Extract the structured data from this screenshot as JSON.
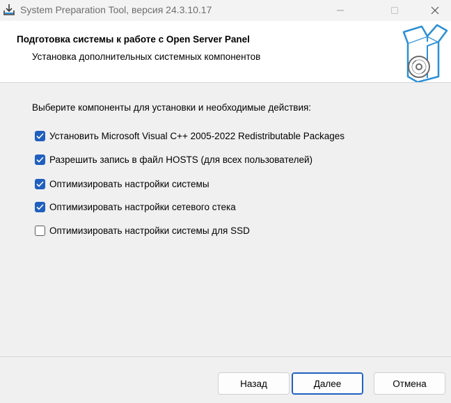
{
  "window": {
    "title": "System Preparation Tool, версия 24.3.10.17"
  },
  "header": {
    "title": "Подготовка системы к работе с Open Server Panel",
    "subtitle": "Установка дополнительных системных компонентов"
  },
  "body": {
    "prompt": "Выберите компоненты для установки и необходимые действия:",
    "options": [
      {
        "label": "Установить Microsoft Visual C++ 2005-2022 Redistributable Packages",
        "checked": true
      },
      {
        "label": "Разрешить запись в файл HOSTS (для всех пользователей)",
        "checked": true
      },
      {
        "label": "Оптимизировать настройки системы",
        "checked": true
      },
      {
        "label": "Оптимизировать настройки сетевого стека",
        "checked": true
      },
      {
        "label": "Оптимизировать настройки системы для SSD",
        "checked": false
      }
    ]
  },
  "buttons": {
    "back": "Назад",
    "next": "Далее",
    "cancel": "Отмена"
  },
  "colors": {
    "accent": "#1f5fbf",
    "header_bg": "#ffffff",
    "body_bg": "#f0f0f0",
    "box_icon": "#2b8fd6"
  },
  "icons": {
    "app": "download-installer-icon",
    "header": "open-box-disc-icon"
  }
}
